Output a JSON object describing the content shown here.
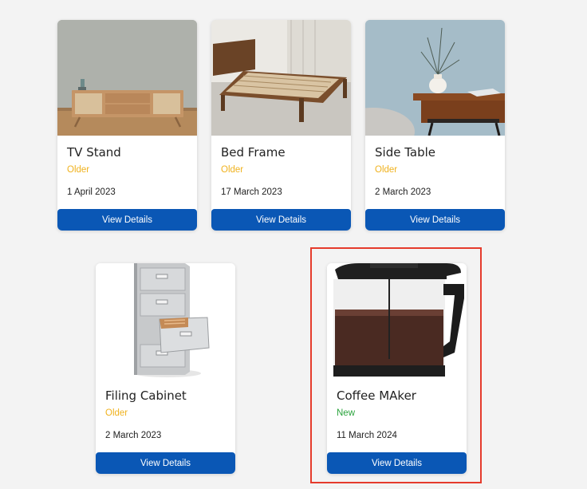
{
  "colors": {
    "button": "#0a57b5",
    "status_older": "#f0b21e",
    "status_new": "#2aa33c",
    "highlight": "#e53b2c"
  },
  "items": [
    {
      "title": "TV Stand",
      "status": "Older",
      "date": "1 April 2023",
      "button_label": "View Details",
      "image_icon": "tv-stand-image"
    },
    {
      "title": "Bed Frame",
      "status": "Older",
      "date": "17 March 2023",
      "button_label": "View Details",
      "image_icon": "bed-frame-image"
    },
    {
      "title": "Side Table",
      "status": "Older",
      "date": "2 March 2023",
      "button_label": "View Details",
      "image_icon": "side-table-image"
    },
    {
      "title": "Filing Cabinet",
      "status": "Older",
      "date": "2 March 2023",
      "button_label": "View Details",
      "image_icon": "filing-cabinet-image"
    },
    {
      "title": "Coffee MAker",
      "status": "New",
      "date": "11 March 2024",
      "button_label": "View Details",
      "image_icon": "coffee-maker-image"
    }
  ]
}
